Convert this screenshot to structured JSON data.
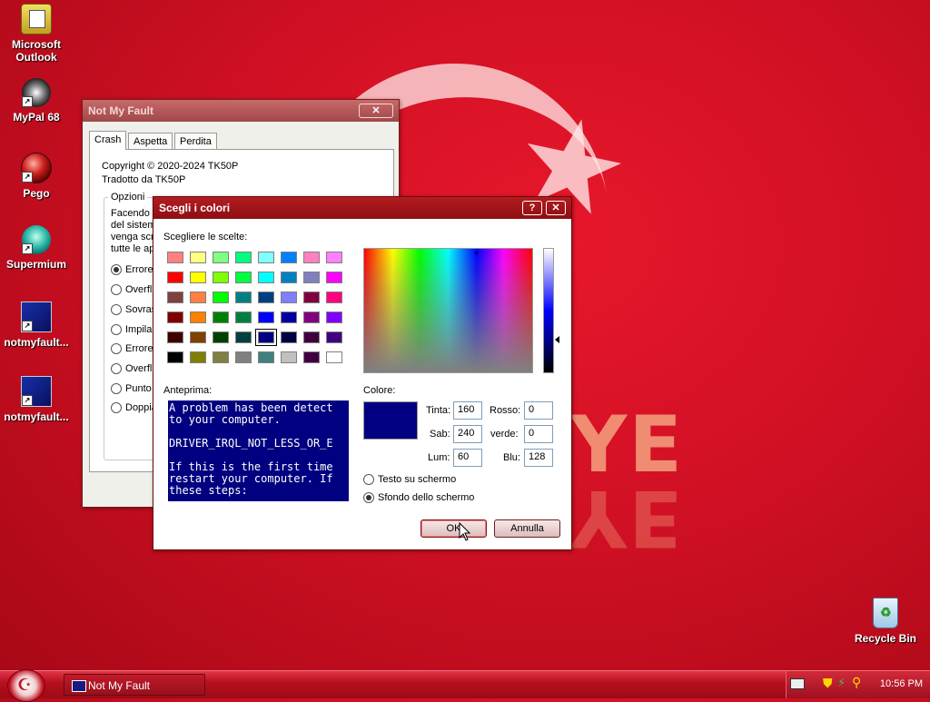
{
  "desktop": {
    "wallpaper_text": "YE",
    "icons": [
      {
        "label": "Microsoft Outlook"
      },
      {
        "label": "MyPal 68"
      },
      {
        "label": "Pego"
      },
      {
        "label": "Supermium"
      },
      {
        "label": "notmyfault..."
      },
      {
        "label": "notmyfault..."
      },
      {
        "label": "Recycle Bin"
      }
    ]
  },
  "nmf_window": {
    "title": "Not My Fault",
    "close": "✕",
    "tabs": [
      "Crash",
      "Aspetta",
      "Perdita"
    ],
    "copyright": "Copyright © 2020-2024 TK50P",
    "translated": "Tradotto da TK50P",
    "options_title": "Opzioni",
    "desc_lines": [
      "Facendo c",
      "del sistem",
      "venga scr",
      "tutte le ap"
    ],
    "radios": [
      "Errore",
      "Overfl",
      "Sovras",
      "Impila",
      "Errore",
      "Overfl",
      "Punto",
      "Doppia"
    ]
  },
  "color_dialog": {
    "title": "Scegli i colori",
    "help": "?",
    "close": "✕",
    "choices_label": "Scegliere le scelte:",
    "preview_label": "Anteprima:",
    "preview_lines": [
      "A problem has been detect",
      "to your computer.",
      "",
      "DRIVER_IRQL_NOT_LESS_OR_E",
      "",
      "If this is the first time",
      "restart your computer. If",
      "these steps:"
    ],
    "color_label": "Colore:",
    "hue_label": "Tinta:",
    "hue": "160",
    "sat_label": "Sab:",
    "sat": "240",
    "lum_label": "Lum:",
    "lum": "60",
    "red_label": "Rosso:",
    "red": "0",
    "green_label": "verde:",
    "green": "0",
    "blue_label": "Blu:",
    "blue": "128",
    "radio_text": "Testo su schermo",
    "radio_bg": "Sfondo dello schermo",
    "ok": "OK",
    "cancel": "Annulla",
    "current_color": "#000080",
    "swatches": [
      [
        "#ff8080",
        "#ffff80",
        "#80ff80",
        "#00ff80",
        "#80ffff",
        "#0080ff",
        "#ff80c0",
        "#ff80ff"
      ],
      [
        "#ff0000",
        "#ffff00",
        "#80ff00",
        "#00ff40",
        "#00ffff",
        "#0080c0",
        "#8080c0",
        "#ff00ff"
      ],
      [
        "#804040",
        "#ff8040",
        "#00ff00",
        "#008080",
        "#004080",
        "#8080ff",
        "#800040",
        "#ff0080"
      ],
      [
        "#800000",
        "#ff8000",
        "#008000",
        "#008040",
        "#0000ff",
        "#0000a0",
        "#800080",
        "#8000ff"
      ],
      [
        "#400000",
        "#804000",
        "#004000",
        "#004040",
        "#000080",
        "#000040",
        "#400040",
        "#400080"
      ],
      [
        "#000000",
        "#808000",
        "#808040",
        "#808080",
        "#408080",
        "#c0c0c0",
        "#400040",
        "#ffffff"
      ]
    ],
    "selected_swatch": [
      4,
      4
    ]
  },
  "taskbar": {
    "task_label": "Not My Fault",
    "clock": "10:56 PM"
  }
}
